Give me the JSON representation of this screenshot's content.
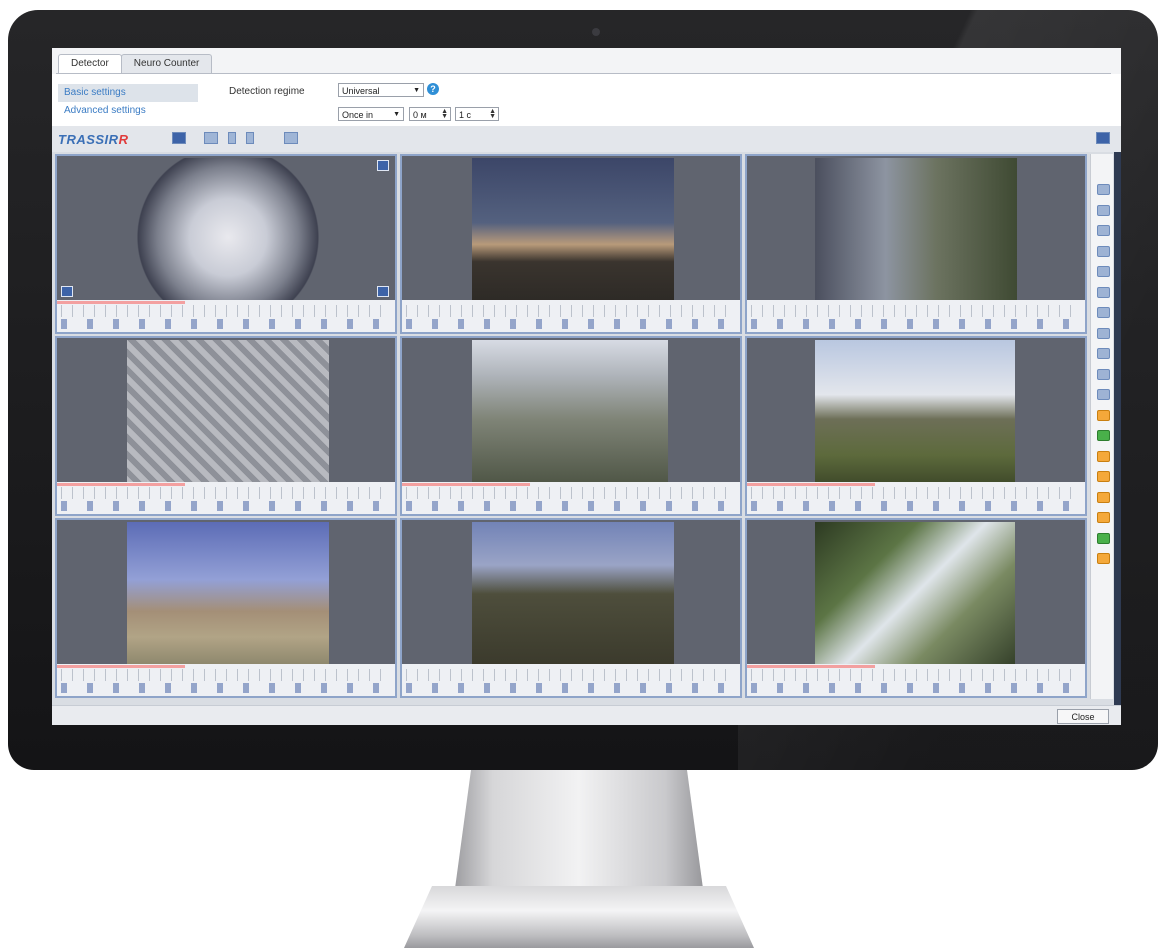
{
  "tabs": [
    {
      "label": "Detector"
    },
    {
      "label": "Neuro Counter"
    }
  ],
  "sidebar": {
    "items": [
      {
        "label": "Basic settings"
      },
      {
        "label": "Advanced settings"
      }
    ]
  },
  "settings": {
    "detection_regime_label": "Detection regime",
    "regime_value": "Universal",
    "interval_value": "Once in",
    "minutes_value": "0 м",
    "seconds_value": "1 с",
    "help_glyph": "?"
  },
  "toolbar": {
    "logo_main": "TRASSIR",
    "logo_accent": "R"
  },
  "footer": {
    "close_label": "Close"
  },
  "colors": {
    "accent_blue": "#3b7cc4",
    "help_blue": "#2f8fd6",
    "camera_border": "#8ea4c9",
    "alarm_orange": "#f4a83a",
    "ok_green": "#49b04a"
  },
  "right_bar_icons": [
    "blue",
    "blue",
    "blue",
    "blue",
    "blue",
    "blue",
    "blue",
    "blue",
    "blue",
    "blue",
    "blue",
    "orange",
    "green",
    "orange",
    "orange",
    "orange",
    "orange",
    "green",
    "orange"
  ]
}
